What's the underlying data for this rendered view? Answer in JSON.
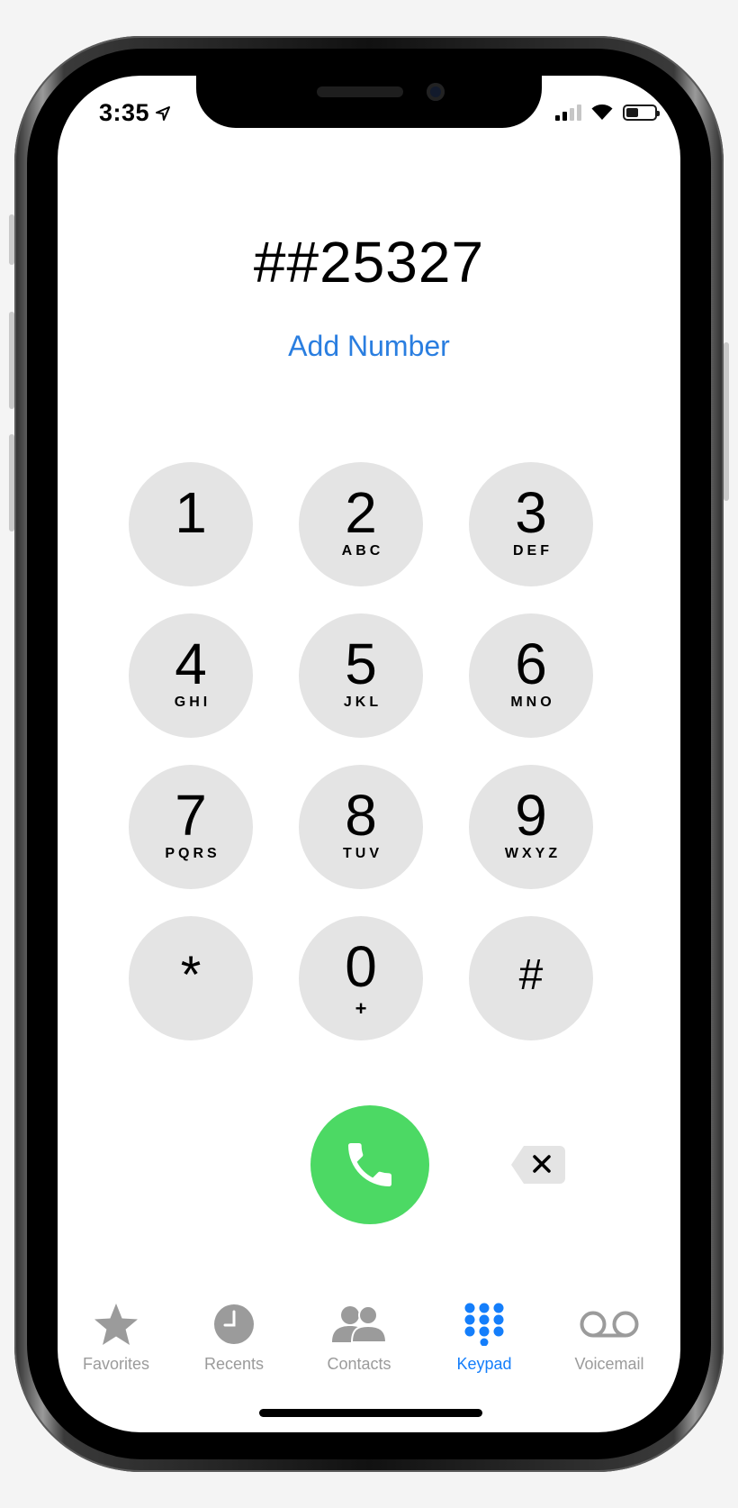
{
  "status_bar": {
    "time": "3:35"
  },
  "dialer": {
    "number": "##25327",
    "add_number_label": "Add Number"
  },
  "keypad": [
    {
      "digit": "1",
      "letters": ""
    },
    {
      "digit": "2",
      "letters": "ABC"
    },
    {
      "digit": "3",
      "letters": "DEF"
    },
    {
      "digit": "4",
      "letters": "GHI"
    },
    {
      "digit": "5",
      "letters": "JKL"
    },
    {
      "digit": "6",
      "letters": "MNO"
    },
    {
      "digit": "7",
      "letters": "PQRS"
    },
    {
      "digit": "8",
      "letters": "TUV"
    },
    {
      "digit": "9",
      "letters": "WXYZ"
    },
    {
      "digit": "*",
      "letters": ""
    },
    {
      "digit": "0",
      "letters": "+"
    },
    {
      "digit": "#",
      "letters": ""
    }
  ],
  "tabs": [
    {
      "label": "Favorites",
      "icon": "star-icon",
      "active": false
    },
    {
      "label": "Recents",
      "icon": "clock-icon",
      "active": false
    },
    {
      "label": "Contacts",
      "icon": "contacts-icon",
      "active": false
    },
    {
      "label": "Keypad",
      "icon": "keypad-grid-icon",
      "active": true
    },
    {
      "label": "Voicemail",
      "icon": "voicemail-icon",
      "active": false
    }
  ],
  "colors": {
    "accent": "#147efb",
    "call": "#4cd964",
    "key_background": "#e4e4e4",
    "inactive_tab": "#9b9b9b"
  }
}
